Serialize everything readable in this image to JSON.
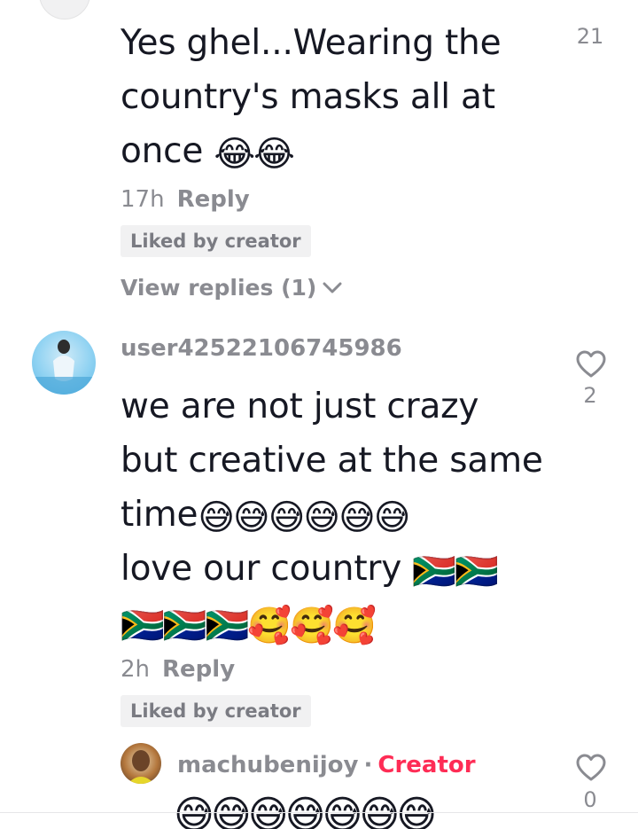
{
  "comments": [
    {
      "text_line1": "Yes ghel...Wearing the",
      "text_line2": "country's masks all at",
      "text_line3": "once",
      "emojis_line3": "😂😂",
      "time": "17h",
      "reply_label": "Reply",
      "liked_label": "Liked by creator",
      "view_replies_label": "View replies (1)",
      "likes": "21"
    },
    {
      "username": "user42522106745986",
      "text_line1": "we are not just crazy",
      "text_line2": "but creative at the same",
      "text_line3": "time",
      "emojis_line3": "😅😅😅😅😅😅",
      "text_line4": "love our country",
      "emojis_line4": "🇿🇦🇿🇦",
      "emojis_line5": "🇿🇦🇿🇦🇿🇦🥰🥰🥰",
      "time": "2h",
      "reply_label": "Reply",
      "liked_label": "Liked by creator",
      "likes": "2"
    },
    {
      "username": "machubenijoy",
      "separator": "·",
      "badge": "Creator",
      "emojis_partial": "😅😅😅😅😅😅😅",
      "likes": "0"
    }
  ],
  "icons": {
    "close": "close-icon",
    "heart": "heart-outline-icon",
    "chevron": "chevron-down-icon"
  },
  "colors": {
    "text": "#161823",
    "muted": "#8a8b91",
    "creator": "#fe2c55",
    "badge_bg": "#f1f1f2"
  }
}
